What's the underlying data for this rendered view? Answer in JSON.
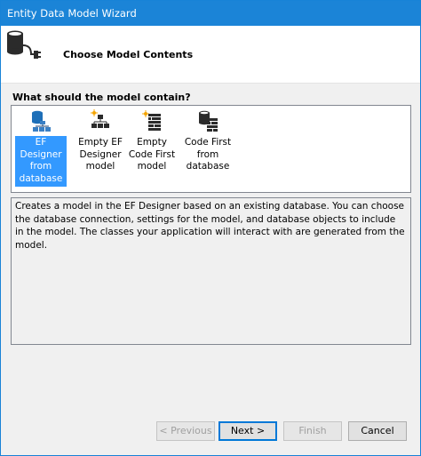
{
  "window": {
    "title": "Entity Data Model Wizard"
  },
  "header": {
    "page_title": "Choose Model Contents",
    "icon": "database-plug-icon"
  },
  "question": "What should the model contain?",
  "options": [
    {
      "label": "EF Designer from database",
      "icon": "ef-designer-db-icon",
      "selected": true
    },
    {
      "label": "Empty EF Designer model",
      "icon": "empty-ef-designer-icon",
      "selected": false
    },
    {
      "label": "Empty Code First model",
      "icon": "empty-code-first-icon",
      "selected": false
    },
    {
      "label": "Code First from database",
      "icon": "code-first-db-icon",
      "selected": false
    }
  ],
  "description": "Creates a model in the EF Designer based on an existing database. You can choose the database connection, settings for the model, and database objects to include in the model. The classes your application will interact with are generated from the model.",
  "buttons": {
    "previous": "< Previous",
    "next": "Next >",
    "finish": "Finish",
    "cancel": "Cancel"
  },
  "colors": {
    "titlebar": "#1b84d7",
    "selection": "#3399ff",
    "default_button_border": "#0078d7"
  }
}
